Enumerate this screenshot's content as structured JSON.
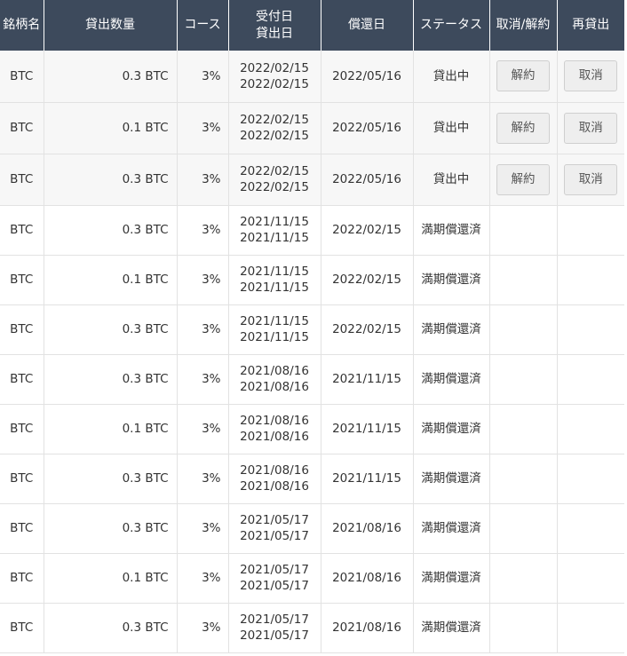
{
  "table": {
    "headers": {
      "symbol": "銘柄名",
      "amount": "貸出数量",
      "course": "コース",
      "date_received": "受付日",
      "date_lent": "貸出日",
      "repayment_date": "償還日",
      "status": "ステータス",
      "cancel": "取消/解約",
      "relend": "再貸出"
    },
    "rows": [
      {
        "symbol": "BTC",
        "amount": "0.3 BTC",
        "course": "3%",
        "received": "2022/02/15",
        "lent": "2022/02/15",
        "repayment": "2022/05/16",
        "status": "貸出中",
        "cancel_label": "解約",
        "relend_label": "取消"
      },
      {
        "symbol": "BTC",
        "amount": "0.1 BTC",
        "course": "3%",
        "received": "2022/02/15",
        "lent": "2022/02/15",
        "repayment": "2022/05/16",
        "status": "貸出中",
        "cancel_label": "解約",
        "relend_label": "取消"
      },
      {
        "symbol": "BTC",
        "amount": "0.3 BTC",
        "course": "3%",
        "received": "2022/02/15",
        "lent": "2022/02/15",
        "repayment": "2022/05/16",
        "status": "貸出中",
        "cancel_label": "解約",
        "relend_label": "取消"
      },
      {
        "symbol": "BTC",
        "amount": "0.3 BTC",
        "course": "3%",
        "received": "2021/11/15",
        "lent": "2021/11/15",
        "repayment": "2022/02/15",
        "status": "満期償還済"
      },
      {
        "symbol": "BTC",
        "amount": "0.1 BTC",
        "course": "3%",
        "received": "2021/11/15",
        "lent": "2021/11/15",
        "repayment": "2022/02/15",
        "status": "満期償還済"
      },
      {
        "symbol": "BTC",
        "amount": "0.3 BTC",
        "course": "3%",
        "received": "2021/11/15",
        "lent": "2021/11/15",
        "repayment": "2022/02/15",
        "status": "満期償還済"
      },
      {
        "symbol": "BTC",
        "amount": "0.3 BTC",
        "course": "3%",
        "received": "2021/08/16",
        "lent": "2021/08/16",
        "repayment": "2021/11/15",
        "status": "満期償還済"
      },
      {
        "symbol": "BTC",
        "amount": "0.1 BTC",
        "course": "3%",
        "received": "2021/08/16",
        "lent": "2021/08/16",
        "repayment": "2021/11/15",
        "status": "満期償還済"
      },
      {
        "symbol": "BTC",
        "amount": "0.3 BTC",
        "course": "3%",
        "received": "2021/08/16",
        "lent": "2021/08/16",
        "repayment": "2021/11/15",
        "status": "満期償還済"
      },
      {
        "symbol": "BTC",
        "amount": "0.3 BTC",
        "course": "3%",
        "received": "2021/05/17",
        "lent": "2021/05/17",
        "repayment": "2021/08/16",
        "status": "満期償還済"
      },
      {
        "symbol": "BTC",
        "amount": "0.1 BTC",
        "course": "3%",
        "received": "2021/05/17",
        "lent": "2021/05/17",
        "repayment": "2021/08/16",
        "status": "満期償還済"
      },
      {
        "symbol": "BTC",
        "amount": "0.3 BTC",
        "course": "3%",
        "received": "2021/05/17",
        "lent": "2021/05/17",
        "repayment": "2021/08/16",
        "status": "満期償還済"
      }
    ]
  },
  "colors": {
    "header_bg": "#3d4a5c",
    "header_text": "#ffffff",
    "active_row_bg": "#f7f7f7",
    "border": "#e2e2e2",
    "button_bg": "#eeeeee"
  }
}
